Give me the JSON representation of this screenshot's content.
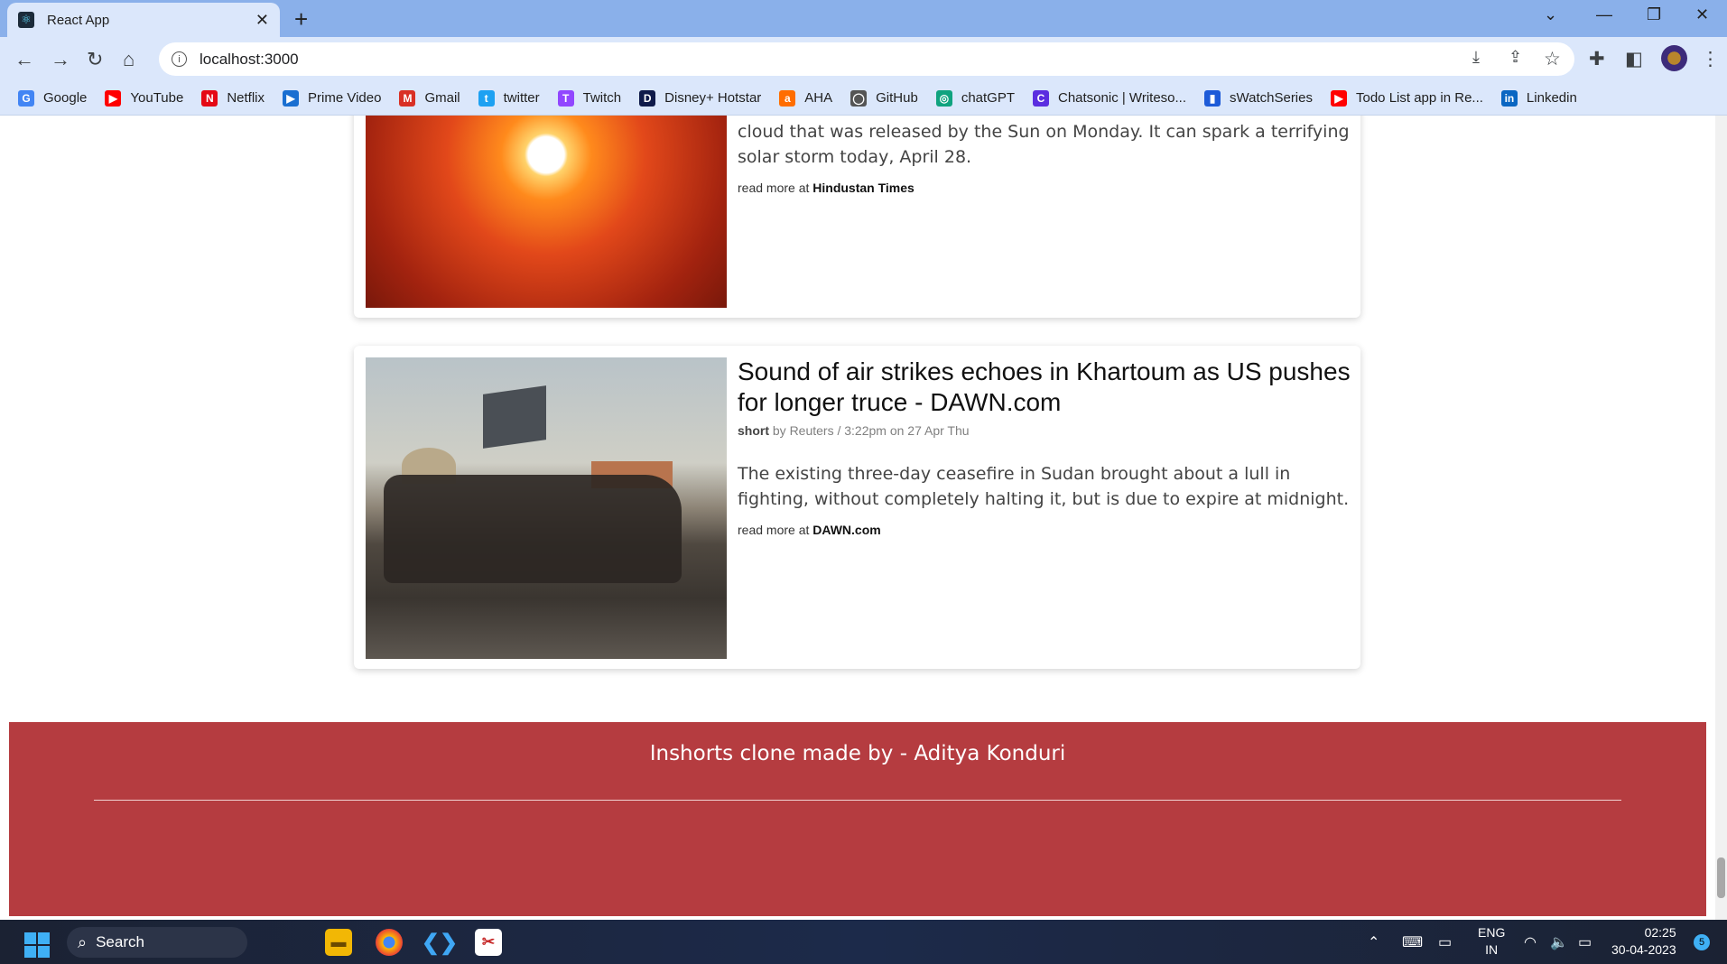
{
  "browser": {
    "tab_title": "React App",
    "tab_close": "✕",
    "new_tab": "+",
    "url": "localhost:3000",
    "bookmarks": [
      {
        "label": "Google",
        "icon": "G",
        "color": "#4285f4"
      },
      {
        "label": "YouTube",
        "icon": "▶",
        "color": "#ff0000"
      },
      {
        "label": "Netflix",
        "icon": "N",
        "color": "#e50914"
      },
      {
        "label": "Prime Video",
        "icon": "▶",
        "color": "#1a6fd1"
      },
      {
        "label": "Gmail",
        "icon": "M",
        "color": "#d93025"
      },
      {
        "label": "twitter",
        "icon": "t",
        "color": "#1da1f2"
      },
      {
        "label": "Twitch",
        "icon": "T",
        "color": "#9146ff"
      },
      {
        "label": "Disney+ Hotstar",
        "icon": "D",
        "color": "#0f1a4a"
      },
      {
        "label": "AHA",
        "icon": "a",
        "color": "#ff6d00"
      },
      {
        "label": "GitHub",
        "icon": "◯",
        "color": "#555555"
      },
      {
        "label": "chatGPT",
        "icon": "◎",
        "color": "#10a37f"
      },
      {
        "label": "Chatsonic | Writeso...",
        "icon": "C",
        "color": "#5b2ee0"
      },
      {
        "label": "sWatchSeries",
        "icon": "▮",
        "color": "#1e5bd8"
      },
      {
        "label": "Todo List app in Re...",
        "icon": "▶",
        "color": "#ff0000"
      },
      {
        "label": "Linkedin",
        "icon": "in",
        "color": "#0a66c2"
      }
    ]
  },
  "articles": [
    {
      "description": "Forecasters have predicted that the Earth can be hit by a flanking CME cloud that was released by the Sun on Monday. It can spark a terrifying solar storm today, April 28.",
      "read_more_prefix": "read more at",
      "source": "Hindustan Times"
    },
    {
      "headline": "Sound of air strikes echoes in Khartoum as US pushes for longer truce - DAWN.com",
      "short_label": "short",
      "byline": "by Reuters / 3:22pm on 27 Apr Thu",
      "description": "The existing three-day ceasefire in Sudan brought about a lull in fighting, without completely halting it, but is due to expire at midnight.",
      "read_more_prefix": "read more at",
      "source": "DAWN.com"
    }
  ],
  "footer": {
    "credit": "Inshorts clone made by - Aditya Konduri"
  },
  "taskbar": {
    "search_label": "Search",
    "lang_line1": "ENG",
    "lang_line2": "IN",
    "time": "02:25",
    "date": "30-04-2023",
    "notifications": "5"
  }
}
